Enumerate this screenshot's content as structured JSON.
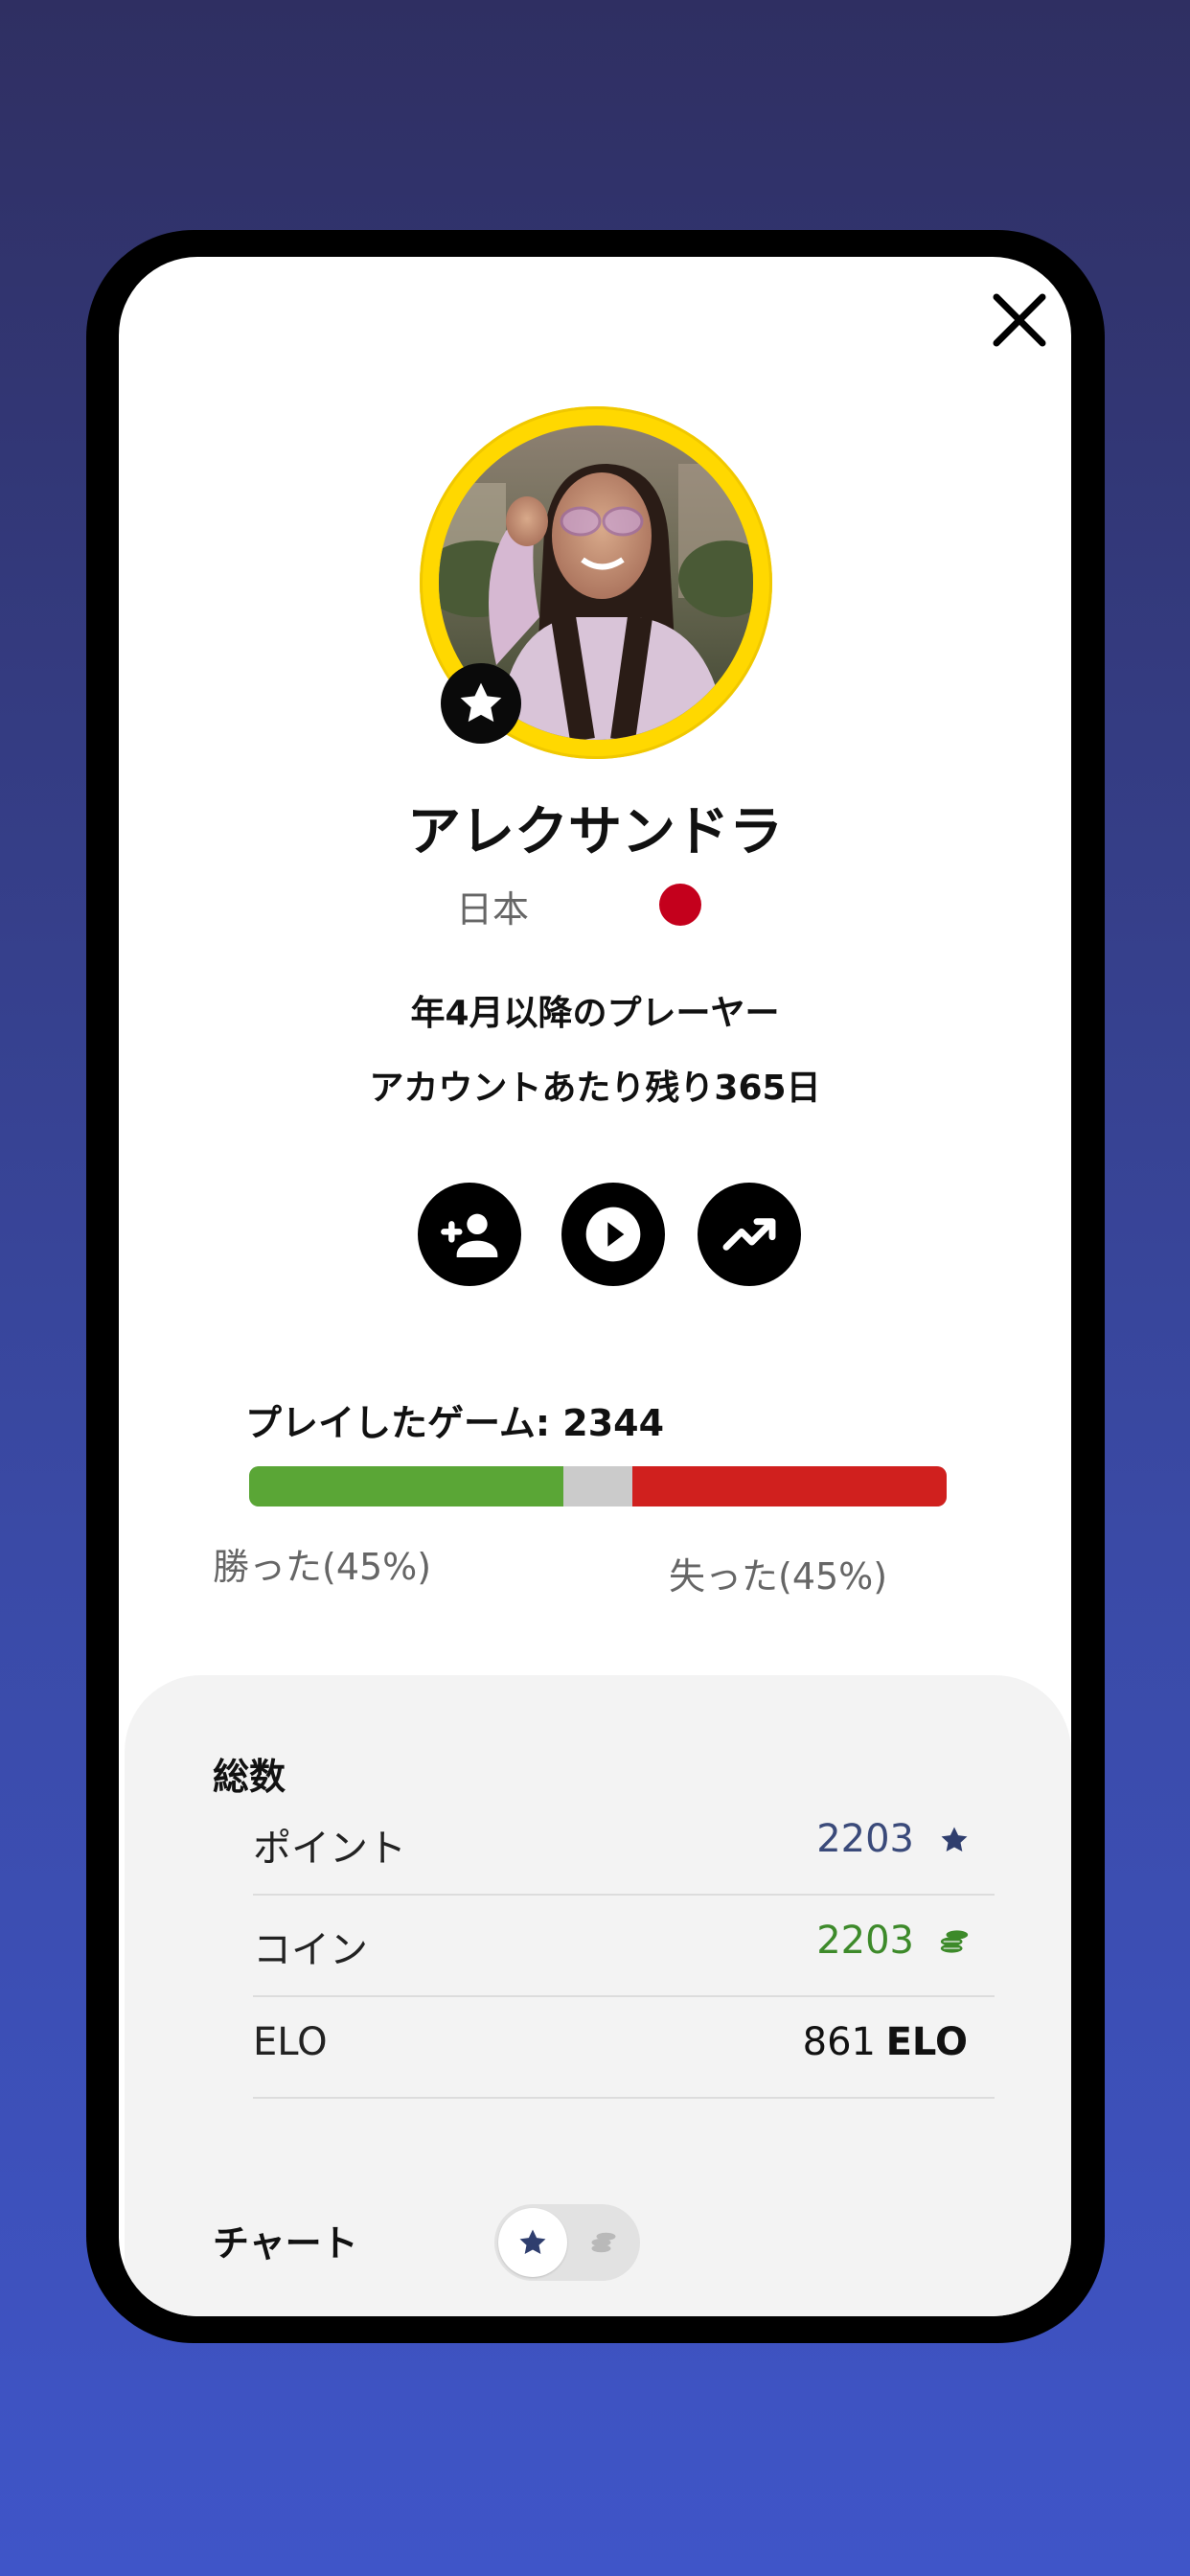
{
  "profile": {
    "name": "アレクサンドラ",
    "country": "日本",
    "since": "年4月以降のプレーヤー",
    "remaining": "アカウントあたり残り365日"
  },
  "games": {
    "label": "プレイしたゲーム:",
    "count": "2344",
    "won_fraction": 0.45,
    "lost_fraction": 0.45,
    "won_label": "勝った(45%)",
    "lost_label": "失った(45%)"
  },
  "totals": {
    "title": "総数",
    "points_label": "ポイント",
    "points_value": "2203",
    "coins_label": "コイン",
    "coins_value": "2203",
    "elo_label": "ELO",
    "elo_value": "861",
    "elo_unit": "ELO"
  },
  "chart": {
    "label": "チャート"
  },
  "colors": {
    "accent_ring": "#ffd800",
    "won": "#5aa636",
    "lost": "#d0201e",
    "points": "#3a4a7a",
    "coins": "#3d8a2a",
    "flag": "#c4001c"
  },
  "icons": {
    "close": "close-icon",
    "badge": "star-icon",
    "add_friend": "person-add-icon",
    "play": "play-circle-icon",
    "stats": "trending-up-icon",
    "points": "star-icon",
    "coins": "coins-icon"
  }
}
